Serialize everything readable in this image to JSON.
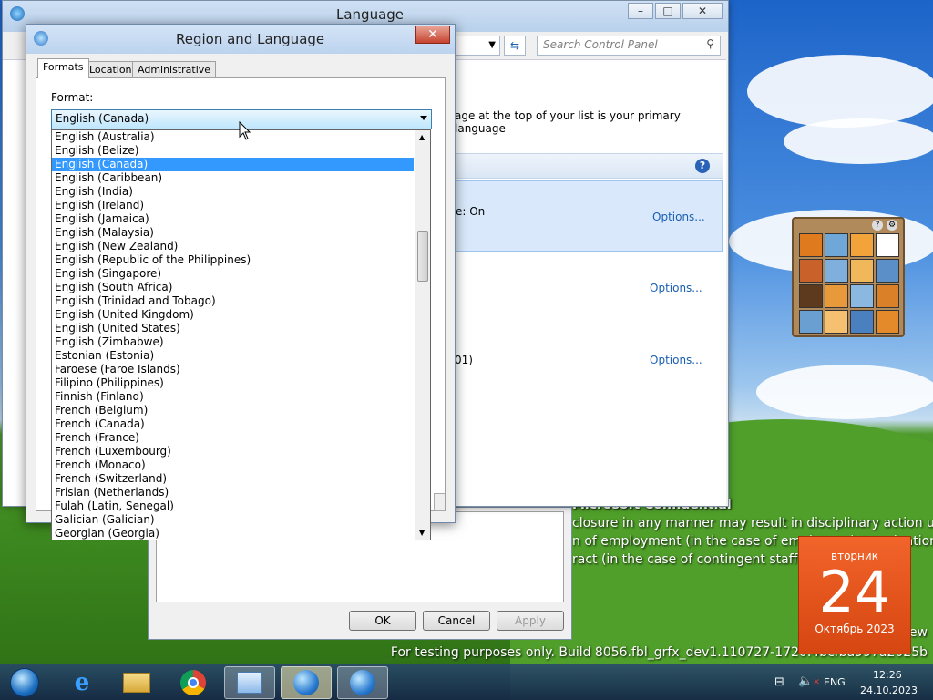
{
  "language_window": {
    "title": "Language",
    "search_placeholder": "Search Control Panel",
    "primary_language_text": "age at the top of your list is your primary language",
    "option_on_text": "e: On",
    "options_labels": [
      "Options...",
      "Options...",
      "Options..."
    ],
    "partial_text": "01)"
  },
  "dialog": {
    "title": "Region and Language",
    "tabs": [
      "Formats",
      "Location",
      "Administrative"
    ],
    "format_label": "Format:",
    "selected_format": "English (Canada)"
  },
  "dropdown_items": [
    "English (Australia)",
    "English (Belize)",
    "English (Canada)",
    "English (Caribbean)",
    "English (India)",
    "English (Ireland)",
    "English (Jamaica)",
    "English (Malaysia)",
    "English (New Zealand)",
    "English (Republic of the Philippines)",
    "English (Singapore)",
    "English (South Africa)",
    "English (Trinidad and Tobago)",
    "English (United Kingdom)",
    "English (United States)",
    "English (Zimbabwe)",
    "Estonian (Estonia)",
    "Faroese (Faroe Islands)",
    "Filipino (Philippines)",
    "Finnish (Finland)",
    "French (Belgium)",
    "French (Canada)",
    "French (France)",
    "French (Luxembourg)",
    "French (Monaco)",
    "French (Switzerland)",
    "Frisian (Netherlands)",
    "Fulah (Latin, Senegal)",
    "Galician (Galician)",
    "Georgian (Georgia)"
  ],
  "selected_index": 2,
  "back_window": {
    "ok_label": "OK",
    "cancel_label": "Cancel",
    "apply_label": "Apply"
  },
  "desktop": {
    "warning_title": "Microsoft Confidential",
    "warning_lines": [
      "closure in any manner may result in disciplinary action up to",
      "n of employment (in the case of employees), termination",
      "ract (in the case of contingent staff), a"
    ],
    "windows_line": "Windo                                                                              ew",
    "build_line": "For testing purposes only. Build 8056.fbl_grfx_dev1.110727-1720.4bcfba997a2025b"
  },
  "calendar": {
    "weekday": "вторник",
    "day": "24",
    "month_year": "Октябрь 2023"
  },
  "taskbar": {
    "lang": "ENG",
    "time": "12:26",
    "date": "24.10.2023"
  }
}
